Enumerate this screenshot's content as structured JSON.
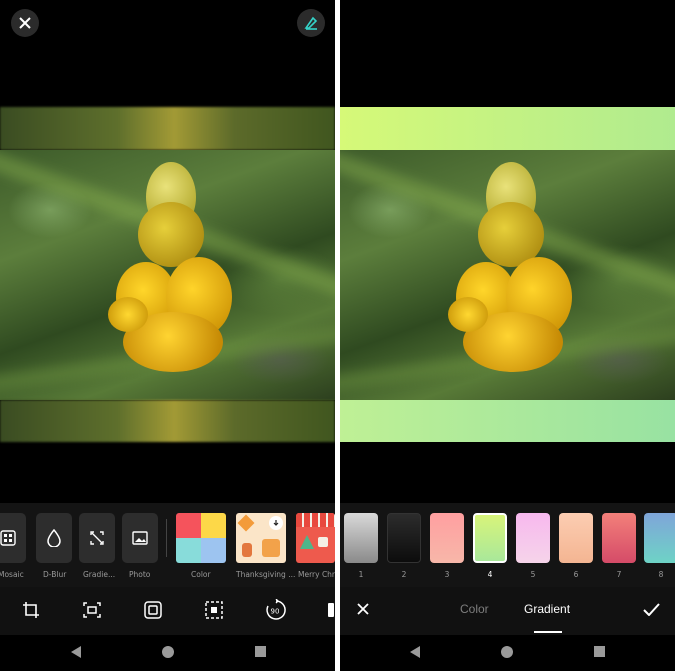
{
  "left_panel": {
    "close_icon": "close-icon",
    "edit_icon": "eraser-edit-icon",
    "tools": [
      {
        "label": "Mosaic",
        "icon": "mosaic-icon"
      },
      {
        "label": "D-Blur",
        "icon": "drop-icon"
      },
      {
        "label": "Gradie...",
        "icon": "expand-icon"
      },
      {
        "label": "Photo",
        "icon": "image-icon"
      }
    ],
    "backgrounds": [
      {
        "label": "Color"
      },
      {
        "label": "Thanksgiving ..."
      },
      {
        "label": "Merry Chris"
      }
    ],
    "bottom_icons": [
      "crop-icon",
      "fit-icon",
      "frame-icon",
      "dashed-select-icon",
      "rotate-90-icon",
      "more-icon"
    ],
    "rotate_label": "90"
  },
  "right_panel": {
    "swatches": [
      {
        "number": "1",
        "colors": [
          "#d9d9d9",
          "#8a8a8a"
        ]
      },
      {
        "number": "2",
        "colors": [
          "#2c2c2c",
          "#0c0c0c"
        ]
      },
      {
        "number": "3",
        "colors": [
          "#ff9fa0",
          "#f7b7a9"
        ]
      },
      {
        "number": "4",
        "colors": [
          "#d8f47a",
          "#a9e89a"
        ],
        "selected": true
      },
      {
        "number": "5",
        "colors": [
          "#f7b8ee",
          "#f6d4ea"
        ]
      },
      {
        "number": "6",
        "colors": [
          "#fccdb2",
          "#f4b592"
        ]
      },
      {
        "number": "7",
        "colors": [
          "#f3807a",
          "#d54b68"
        ]
      },
      {
        "number": "8",
        "colors": [
          "#7fa5d9",
          "#6ed3c6"
        ]
      }
    ],
    "tabs": {
      "color": "Color",
      "gradient": "Gradient"
    },
    "active_tab": "Gradient",
    "accent_gradient": [
      "#d6f978",
      "#a7e5a0"
    ],
    "cancel_icon": "close-icon",
    "confirm_icon": "check-icon"
  },
  "nav": [
    "back-icon",
    "home-icon",
    "recents-icon"
  ]
}
